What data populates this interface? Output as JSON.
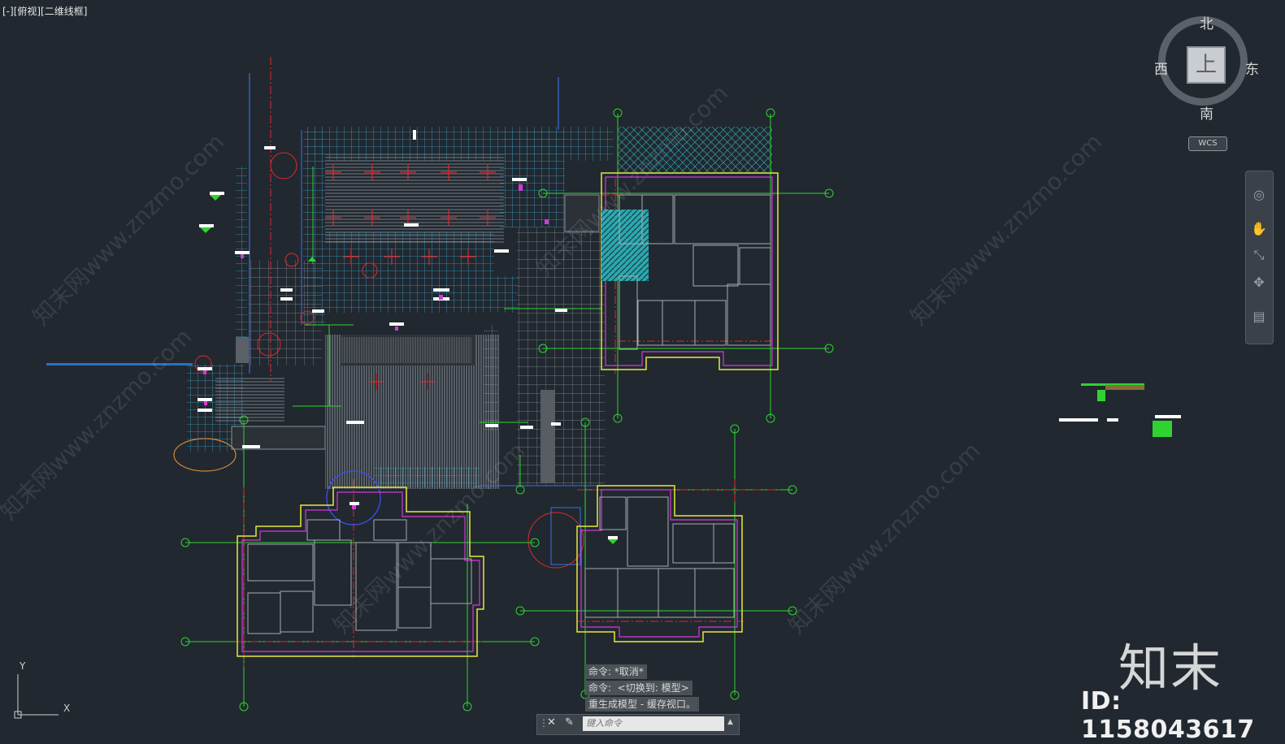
{
  "viewport": {
    "label": "[-][俯视][二维线框]"
  },
  "viewcube": {
    "north": "北",
    "south": "南",
    "west": "西",
    "east": "东",
    "face": "上",
    "wcs": "WCS"
  },
  "ucs": {
    "x": "X",
    "y": "Y"
  },
  "command_history": [
    "命令: *取消*",
    "命令:  <切换到: 模型>",
    "重生成模型 - 缓存视口。"
  ],
  "command_bar": {
    "placeholder": "键入命令"
  },
  "watermark": {
    "logo": "知末",
    "id": "ID: 1158043617",
    "text": "知末网www.znzmo.com"
  },
  "colors": {
    "background": "#212830",
    "axis_red": "#e0282c",
    "axis_green": "#2fd32f",
    "wall_magenta": "#d23ad6",
    "outline_yellow": "#e8e83a",
    "grid_cyan": "#3fa0c8"
  }
}
